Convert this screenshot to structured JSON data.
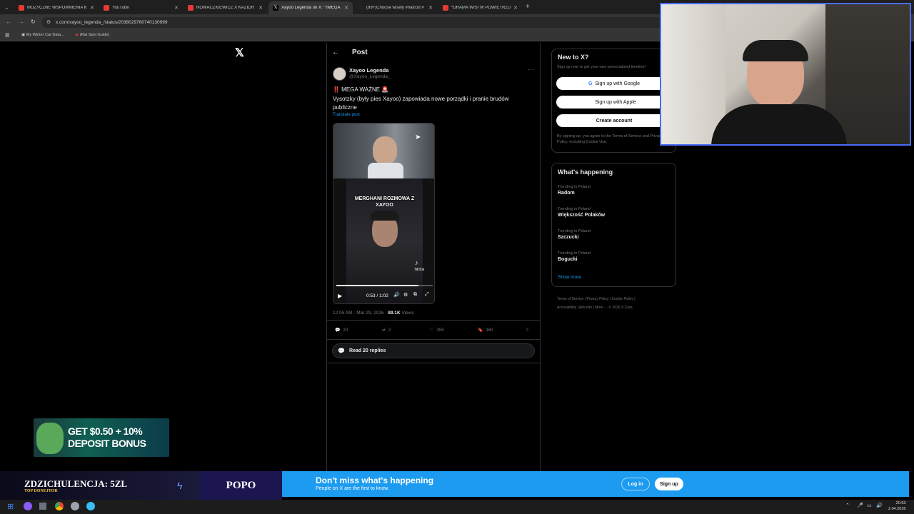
{
  "browser": {
    "tabs": [
      {
        "title": "MUZYCZNE WSPOMNIENIA KO",
        "fav_color": "#e53935"
      },
      {
        "title": "YouTube",
        "fav_color": "#e53935"
      },
      {
        "title": "NOWACZKIEWICZ X KAZIOR -",
        "fav_color": "#e53935"
      },
      {
        "title": "Xayoo Legenda on X: \"!!MEGA",
        "fav_color": "#ffffff"
      },
      {
        "title": "(99+)Choose wisely #haircut #",
        "fav_color": "#ffffff"
      },
      {
        "title": "*DRAMA WISI W POWIETRZU*",
        "fav_color": "#e53935"
      }
    ],
    "url": "x.com/xayoo_legenda_/status/2038029760740130999",
    "bookmarks": [
      "My Winter Car Data...",
      "(Rat Spot Guide)"
    ]
  },
  "x": {
    "logo": "𝕏",
    "post_header": "Post",
    "author_name": "Xayoo Legenda",
    "author_handle": "@Xayoo_Legenda_",
    "post_title": "‼️ MEGA WAŻNE 🚨",
    "post_text": "Vysotzky (były pies Xayoo) zapowiada nowe porządki i pranie brudów publiczne",
    "translate": "Translate post",
    "video_caption": "MERGHANI ROZMOWA Z XAYOO",
    "video_time": "0:53 / 1:02",
    "video_progress": 0.85,
    "tiktok_label": "TikTok",
    "post_time": "12:05 AM · Mar 29, 2026 ·",
    "views_count": "89.1K",
    "views_label": "Views",
    "replies": "20",
    "reposts": "2",
    "likes": "359",
    "bookmarks": "160",
    "read_replies": "Read 20 replies"
  },
  "signup": {
    "title": "New to X?",
    "subtitle": "Sign up now to get your own personalized timeline!",
    "google": "Sign up with Google",
    "apple": "Sign up with Apple",
    "create": "Create account",
    "legal": "By signing up, you agree to the Terms of Service and Privacy Policy, including Cookie Use."
  },
  "trends": {
    "title": "What's happening",
    "items": [
      {
        "category": "Trending in Poland",
        "name": "Radom"
      },
      {
        "category": "Trending in Poland",
        "name": "Większość Polaków"
      },
      {
        "category": "Trending in Poland",
        "name": "Szczucki"
      },
      {
        "category": "Trending in Poland",
        "name": "Bogucki"
      }
    ],
    "show_more": "Show more"
  },
  "footer_links": [
    "Terms of Service",
    "Privacy Policy",
    "Cookie Policy",
    "Accessibility",
    "Ads info",
    "More ···",
    "© 2026 X Corp."
  ],
  "ad": {
    "line1": "GET $0.50 + 10%",
    "line2": "DEPOSIT BONUS"
  },
  "stream": {
    "donor_label": "ZDZICHULENCJA: 5ZL",
    "donor_sub": "TOP DONEJTOR",
    "popo": "POPO"
  },
  "banner": {
    "title": "Don't miss what's happening",
    "subtitle": "People on X are the first to know.",
    "login": "Log in",
    "signup": "Sign up"
  },
  "taskbar": {
    "time": "20:53",
    "date": "2.04.2026"
  },
  "colors": {
    "x_blue": "#1d9bf0",
    "bg": "#000000",
    "border": "#2f3336"
  }
}
